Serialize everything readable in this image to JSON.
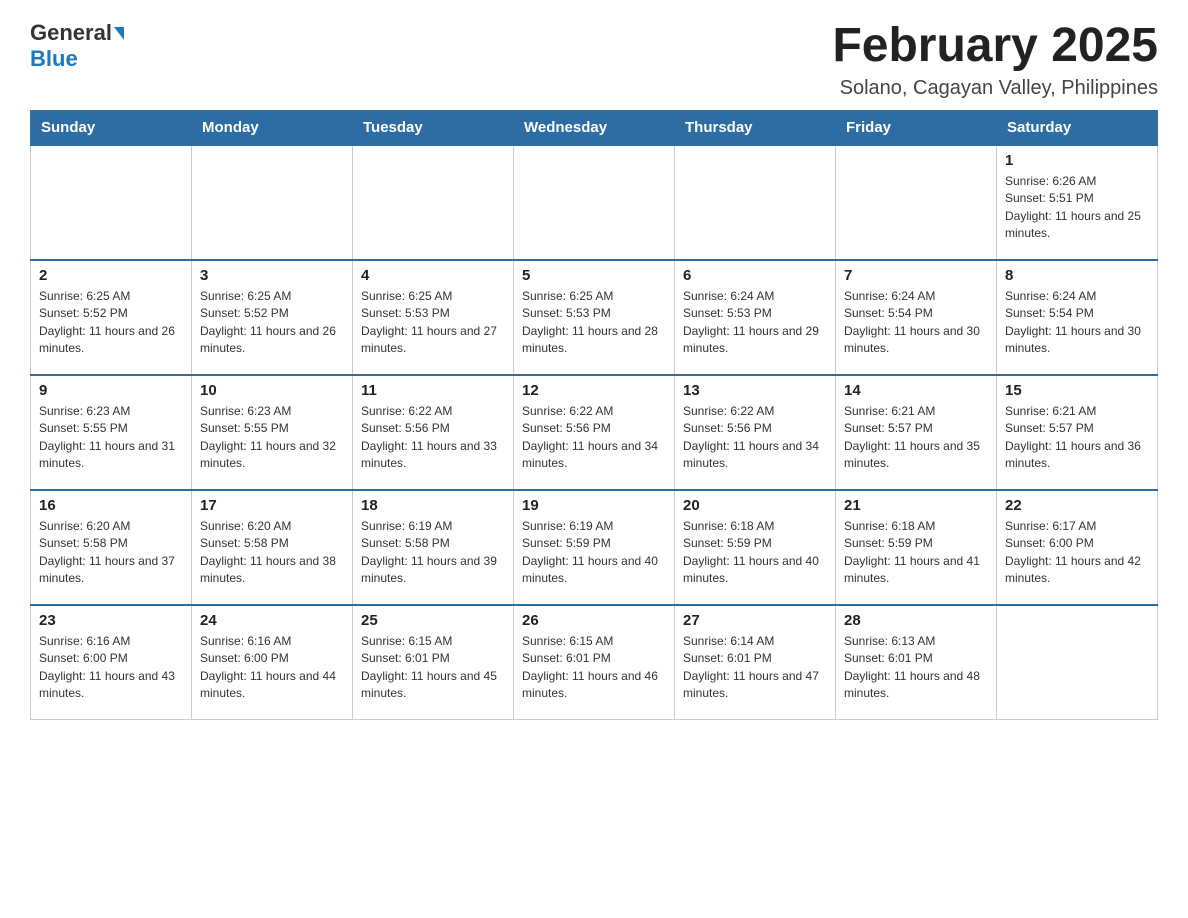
{
  "header": {
    "logo_general": "General",
    "logo_blue": "Blue",
    "month_title": "February 2025",
    "location": "Solano, Cagayan Valley, Philippines"
  },
  "days_of_week": [
    "Sunday",
    "Monday",
    "Tuesday",
    "Wednesday",
    "Thursday",
    "Friday",
    "Saturday"
  ],
  "weeks": [
    [
      {
        "day": "",
        "sunrise": "",
        "sunset": "",
        "daylight": ""
      },
      {
        "day": "",
        "sunrise": "",
        "sunset": "",
        "daylight": ""
      },
      {
        "day": "",
        "sunrise": "",
        "sunset": "",
        "daylight": ""
      },
      {
        "day": "",
        "sunrise": "",
        "sunset": "",
        "daylight": ""
      },
      {
        "day": "",
        "sunrise": "",
        "sunset": "",
        "daylight": ""
      },
      {
        "day": "",
        "sunrise": "",
        "sunset": "",
        "daylight": ""
      },
      {
        "day": "1",
        "sunrise": "Sunrise: 6:26 AM",
        "sunset": "Sunset: 5:51 PM",
        "daylight": "Daylight: 11 hours and 25 minutes."
      }
    ],
    [
      {
        "day": "2",
        "sunrise": "Sunrise: 6:25 AM",
        "sunset": "Sunset: 5:52 PM",
        "daylight": "Daylight: 11 hours and 26 minutes."
      },
      {
        "day": "3",
        "sunrise": "Sunrise: 6:25 AM",
        "sunset": "Sunset: 5:52 PM",
        "daylight": "Daylight: 11 hours and 26 minutes."
      },
      {
        "day": "4",
        "sunrise": "Sunrise: 6:25 AM",
        "sunset": "Sunset: 5:53 PM",
        "daylight": "Daylight: 11 hours and 27 minutes."
      },
      {
        "day": "5",
        "sunrise": "Sunrise: 6:25 AM",
        "sunset": "Sunset: 5:53 PM",
        "daylight": "Daylight: 11 hours and 28 minutes."
      },
      {
        "day": "6",
        "sunrise": "Sunrise: 6:24 AM",
        "sunset": "Sunset: 5:53 PM",
        "daylight": "Daylight: 11 hours and 29 minutes."
      },
      {
        "day": "7",
        "sunrise": "Sunrise: 6:24 AM",
        "sunset": "Sunset: 5:54 PM",
        "daylight": "Daylight: 11 hours and 30 minutes."
      },
      {
        "day": "8",
        "sunrise": "Sunrise: 6:24 AM",
        "sunset": "Sunset: 5:54 PM",
        "daylight": "Daylight: 11 hours and 30 minutes."
      }
    ],
    [
      {
        "day": "9",
        "sunrise": "Sunrise: 6:23 AM",
        "sunset": "Sunset: 5:55 PM",
        "daylight": "Daylight: 11 hours and 31 minutes."
      },
      {
        "day": "10",
        "sunrise": "Sunrise: 6:23 AM",
        "sunset": "Sunset: 5:55 PM",
        "daylight": "Daylight: 11 hours and 32 minutes."
      },
      {
        "day": "11",
        "sunrise": "Sunrise: 6:22 AM",
        "sunset": "Sunset: 5:56 PM",
        "daylight": "Daylight: 11 hours and 33 minutes."
      },
      {
        "day": "12",
        "sunrise": "Sunrise: 6:22 AM",
        "sunset": "Sunset: 5:56 PM",
        "daylight": "Daylight: 11 hours and 34 minutes."
      },
      {
        "day": "13",
        "sunrise": "Sunrise: 6:22 AM",
        "sunset": "Sunset: 5:56 PM",
        "daylight": "Daylight: 11 hours and 34 minutes."
      },
      {
        "day": "14",
        "sunrise": "Sunrise: 6:21 AM",
        "sunset": "Sunset: 5:57 PM",
        "daylight": "Daylight: 11 hours and 35 minutes."
      },
      {
        "day": "15",
        "sunrise": "Sunrise: 6:21 AM",
        "sunset": "Sunset: 5:57 PM",
        "daylight": "Daylight: 11 hours and 36 minutes."
      }
    ],
    [
      {
        "day": "16",
        "sunrise": "Sunrise: 6:20 AM",
        "sunset": "Sunset: 5:58 PM",
        "daylight": "Daylight: 11 hours and 37 minutes."
      },
      {
        "day": "17",
        "sunrise": "Sunrise: 6:20 AM",
        "sunset": "Sunset: 5:58 PM",
        "daylight": "Daylight: 11 hours and 38 minutes."
      },
      {
        "day": "18",
        "sunrise": "Sunrise: 6:19 AM",
        "sunset": "Sunset: 5:58 PM",
        "daylight": "Daylight: 11 hours and 39 minutes."
      },
      {
        "day": "19",
        "sunrise": "Sunrise: 6:19 AM",
        "sunset": "Sunset: 5:59 PM",
        "daylight": "Daylight: 11 hours and 40 minutes."
      },
      {
        "day": "20",
        "sunrise": "Sunrise: 6:18 AM",
        "sunset": "Sunset: 5:59 PM",
        "daylight": "Daylight: 11 hours and 40 minutes."
      },
      {
        "day": "21",
        "sunrise": "Sunrise: 6:18 AM",
        "sunset": "Sunset: 5:59 PM",
        "daylight": "Daylight: 11 hours and 41 minutes."
      },
      {
        "day": "22",
        "sunrise": "Sunrise: 6:17 AM",
        "sunset": "Sunset: 6:00 PM",
        "daylight": "Daylight: 11 hours and 42 minutes."
      }
    ],
    [
      {
        "day": "23",
        "sunrise": "Sunrise: 6:16 AM",
        "sunset": "Sunset: 6:00 PM",
        "daylight": "Daylight: 11 hours and 43 minutes."
      },
      {
        "day": "24",
        "sunrise": "Sunrise: 6:16 AM",
        "sunset": "Sunset: 6:00 PM",
        "daylight": "Daylight: 11 hours and 44 minutes."
      },
      {
        "day": "25",
        "sunrise": "Sunrise: 6:15 AM",
        "sunset": "Sunset: 6:01 PM",
        "daylight": "Daylight: 11 hours and 45 minutes."
      },
      {
        "day": "26",
        "sunrise": "Sunrise: 6:15 AM",
        "sunset": "Sunset: 6:01 PM",
        "daylight": "Daylight: 11 hours and 46 minutes."
      },
      {
        "day": "27",
        "sunrise": "Sunrise: 6:14 AM",
        "sunset": "Sunset: 6:01 PM",
        "daylight": "Daylight: 11 hours and 47 minutes."
      },
      {
        "day": "28",
        "sunrise": "Sunrise: 6:13 AM",
        "sunset": "Sunset: 6:01 PM",
        "daylight": "Daylight: 11 hours and 48 minutes."
      },
      {
        "day": "",
        "sunrise": "",
        "sunset": "",
        "daylight": ""
      }
    ]
  ]
}
